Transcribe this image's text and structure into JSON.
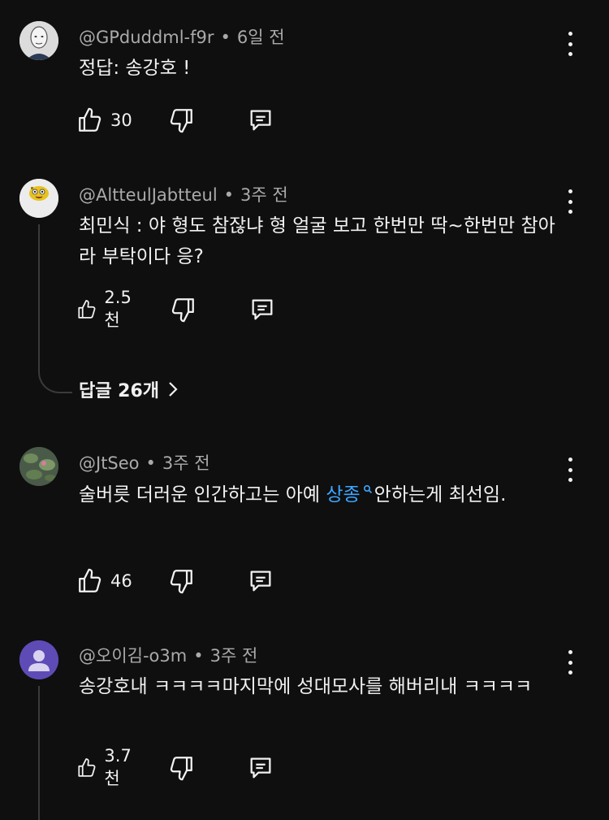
{
  "comments": [
    {
      "author": "@GPduddml-f9r",
      "time": "6일 전",
      "text": "정답: 송강호 !",
      "likes": "30",
      "avatar_icon": "white-face-avatar-icon"
    },
    {
      "author": "@AltteulJabtteul",
      "time": "3주 전",
      "text": "최민식 : 야 형도 참잖냐 형 얼굴 보고 한번만 딱~한번만 참아라 부탁이다 응?",
      "likes": "2.5천",
      "replies": "답글 26개",
      "avatar_icon": "sponge-character-avatar-icon"
    },
    {
      "author": "@JtSeo",
      "time": "3주 전",
      "text_before": "술버릇 더러운 인간하고는 아예 ",
      "link": "상종",
      "text_after": "안하는게 최선임.",
      "likes": "46",
      "avatar_icon": "lily-pad-avatar-icon"
    },
    {
      "author": "@오이김-o3m",
      "time": "3주 전",
      "text": "송강호내 ㅋㅋㅋㅋ마지막에 성대모사를 해버리내 ㅋㅋㅋㅋ",
      "likes": "3.7천",
      "avatar_icon": "default-person-avatar-icon"
    }
  ],
  "colors": {
    "background": "#0f0f0f",
    "text": "#f1f1f1",
    "meta": "#aaaaaa",
    "link": "#3ea6ff",
    "default_avatar": "#5f4bb6"
  }
}
